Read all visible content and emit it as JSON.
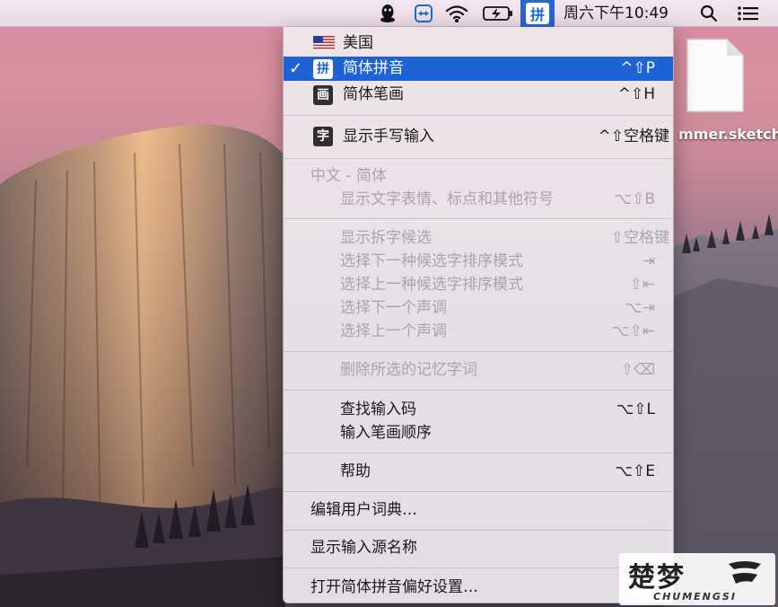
{
  "menubar": {
    "clock": "周六下午10:49",
    "ime_badge": "拼",
    "icons": [
      "qq-icon",
      "teamviewer-icon",
      "wifi-icon",
      "battery-charging-icon",
      "input-method-icon",
      "spotlight-search-icon",
      "notification-center-icon"
    ]
  },
  "desktop": {
    "file_name": "mmer.sketch"
  },
  "menu": {
    "sources": [
      {
        "label": "美国",
        "shortcut": "",
        "selected": false
      },
      {
        "label": "简体拼音",
        "shortcut": "^⇧P",
        "selected": true,
        "icon_text": "拼"
      },
      {
        "label": "简体笔画",
        "shortcut": "^⇧H",
        "selected": false,
        "icon_text": "画"
      }
    ],
    "handwriting": {
      "label": "显示手写输入",
      "shortcut": "^⇧空格键",
      "icon_text": "字"
    },
    "section_header": "中文 - 简体",
    "emoji": {
      "label": "显示文字表情、标点和其他符号",
      "shortcut": "⌥⇧B"
    },
    "candidate_items": [
      {
        "label": "显示拆字候选",
        "shortcut": "⇧空格键"
      },
      {
        "label": "选择下一种候选字排序模式",
        "shortcut": "⇥"
      },
      {
        "label": "选择上一种候选字排序模式",
        "shortcut": "⇧⇤"
      },
      {
        "label": "选择下一个声调",
        "shortcut": "⌥⇥"
      },
      {
        "label": "选择上一个声调",
        "shortcut": "⌥⇧⇤"
      }
    ],
    "delete_memory": {
      "label": "删除所选的记忆字词",
      "shortcut": "⇧⌫"
    },
    "lookup": {
      "label": "查找输入码",
      "shortcut": "⌥⇧L"
    },
    "stroke_order": {
      "label": "输入笔画顺序",
      "shortcut": ""
    },
    "help": {
      "label": "帮助",
      "shortcut": "⌥⇧E"
    },
    "edit_dict": "编辑用户词典…",
    "show_source_name": "显示输入源名称",
    "open_prefs": "打开简体拼音偏好设置…"
  },
  "watermark": {
    "logo_text": "楚梦",
    "sub_text": "CHUMENGSI"
  }
}
